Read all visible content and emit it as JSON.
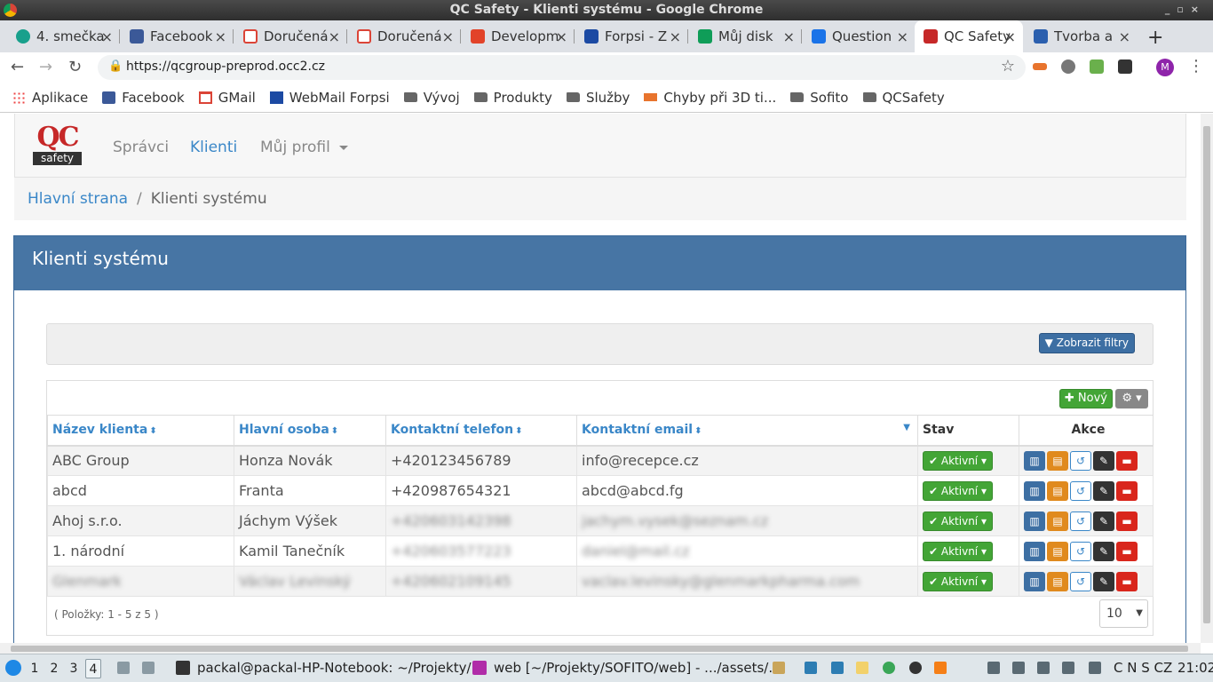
{
  "window": {
    "title": "QC Safety - Klienti systému - Google Chrome"
  },
  "tabs": [
    {
      "label": "4. smečka",
      "color": "#18a08c"
    },
    {
      "label": "Facebook",
      "color": "#3b5998"
    },
    {
      "label": "Doručená",
      "color": "#db4437"
    },
    {
      "label": "Doručená",
      "color": "#db4437"
    },
    {
      "label": "Developme",
      "color": "#e24329"
    },
    {
      "label": "Forpsi - Z",
      "color": "#1c4aa3"
    },
    {
      "label": "Můj disk",
      "color": "#0f9d58"
    },
    {
      "label": "Question",
      "color": "#1a73e8"
    },
    {
      "label": "QC Safety",
      "color": "#c62828",
      "active": true
    },
    {
      "label": "Tvorba a",
      "color": "#2b5fae"
    }
  ],
  "address": {
    "url": "https://qcgroup-preprod.occ2.cz"
  },
  "avatar": {
    "letter": "M"
  },
  "bookmarks": [
    {
      "label": "Aplikace",
      "icon": "apps-icon"
    },
    {
      "label": "Facebook",
      "icon": "facebook-icon"
    },
    {
      "label": "GMail",
      "icon": "gmail-icon"
    },
    {
      "label": "WebMail Forpsi",
      "icon": "forpsi-icon"
    },
    {
      "label": "Vývoj",
      "icon": "folder-icon"
    },
    {
      "label": "Produkty",
      "icon": "folder-icon"
    },
    {
      "label": "Služby",
      "icon": "folder-icon"
    },
    {
      "label": "Chyby při 3D ti...",
      "icon": "3d-icon"
    },
    {
      "label": "Sofito",
      "icon": "folder-icon"
    },
    {
      "label": "QCSafety",
      "icon": "folder-icon"
    }
  ],
  "app": {
    "logo_top": "QC",
    "logo_bottom": "safety",
    "nav": {
      "spravci": "Správci",
      "klienti": "Klienti",
      "profil": "Můj profil"
    },
    "breadcrumb": {
      "home": "Hlavní strana",
      "current": "Klienti systému"
    },
    "panel_title": "Klienti systému",
    "filter_button": "Zobrazit filtry",
    "new_button": "Nový",
    "columns": {
      "nazev": "Název klienta",
      "osoba": "Hlavní osoba",
      "telefon": "Kontaktní telefon",
      "email": "Kontaktní email",
      "stav": "Stav",
      "akce": "Akce"
    },
    "status_label": "Aktivní",
    "rows": [
      {
        "nazev": "ABC Group",
        "osoba": "Honza Novák",
        "telefon": "+420123456789",
        "email": "info@recepce.cz"
      },
      {
        "nazev": "abcd",
        "osoba": "Franta",
        "telefon": "+420987654321",
        "email": "abcd@abcd.fg"
      },
      {
        "nazev": "Ahoj s.r.o.",
        "osoba": "Jáchym Výšek",
        "telefon": "+420603142398",
        "email": "jachym.vysek@seznam.cz"
      },
      {
        "nazev": "1. národní",
        "osoba": "Kamil Tanečník",
        "telefon": "+420603577223",
        "email": "daniel@mail.cz"
      },
      {
        "nazev": "Glenmark",
        "osoba": "Václav Levinský",
        "telefon": "+420602109145",
        "email": "vaclav.levinsky@glenmarkpharma.com"
      }
    ],
    "count_text": "( Položky: 1 - 5 z 5 )",
    "per_page": "10"
  },
  "taskbar": {
    "workspaces": [
      "1",
      "2",
      "3",
      "4"
    ],
    "current_workspace": "4",
    "apps": [
      {
        "label": "packal@packal-HP-Notebook: ~/Projekty/..."
      },
      {
        "label": "web [~/Projekty/SOFITO/web] - .../assets/..."
      }
    ],
    "keyboard": "C N S CZ",
    "clock": "21:02"
  }
}
